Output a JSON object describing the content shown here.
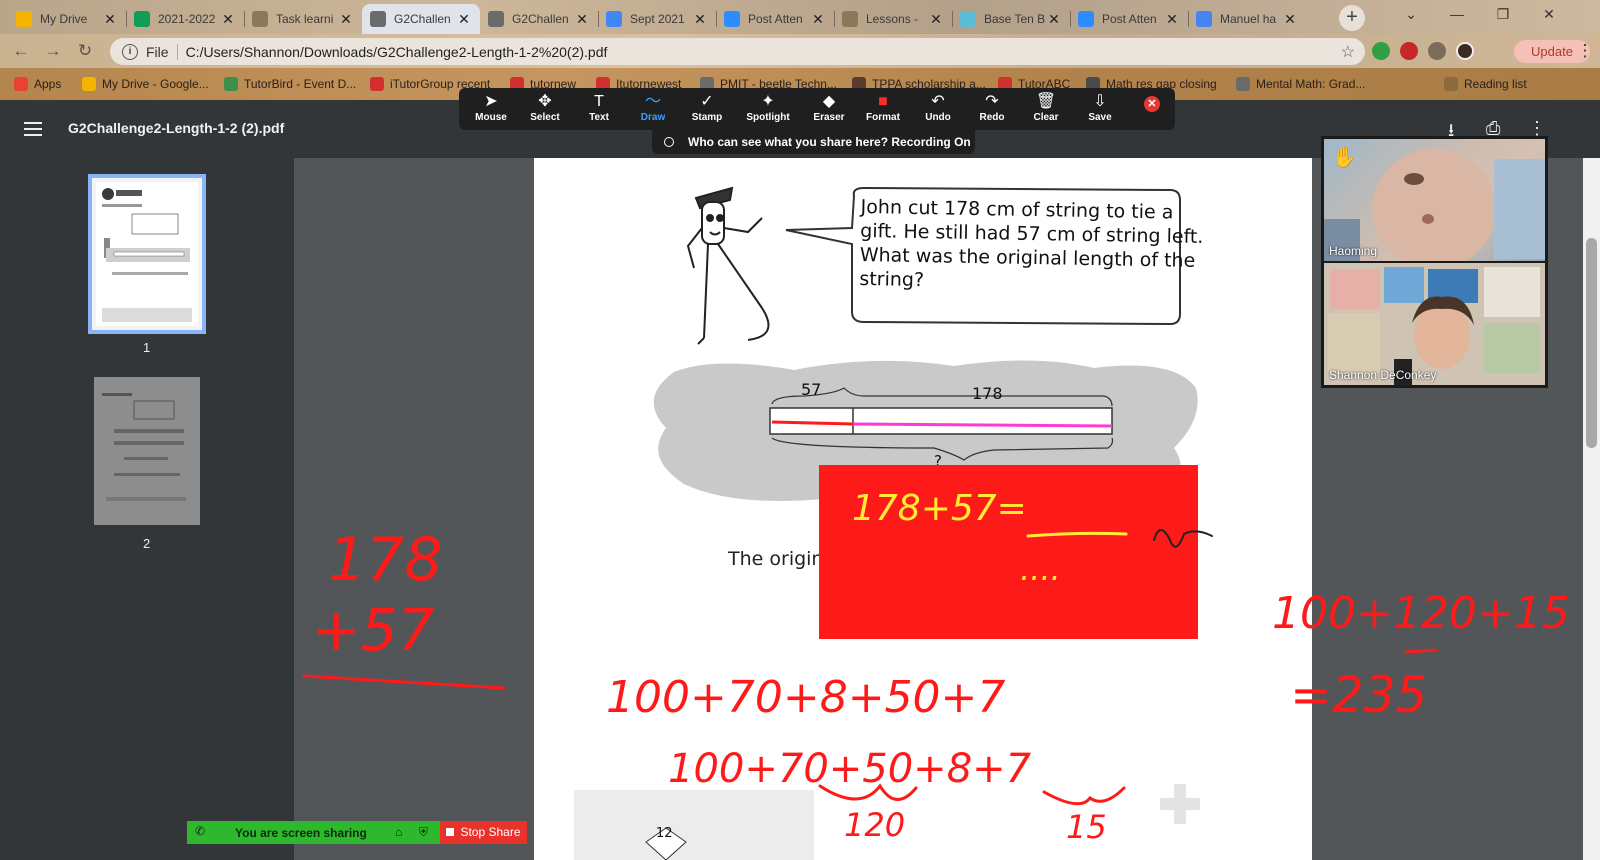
{
  "browser": {
    "tabs": [
      {
        "label": "My Drive",
        "icon": "google-drive-icon",
        "color": "#f4b400",
        "active": false
      },
      {
        "label": "2021-2022",
        "icon": "google-sheets-icon",
        "color": "#0f9d58",
        "active": false
      },
      {
        "label": "Task learni",
        "icon": "document-icon",
        "color": "#8a7a5a",
        "active": false
      },
      {
        "label": "G2Challen",
        "icon": "globe-icon",
        "color": "#6b6b6b",
        "active": true
      },
      {
        "label": "G2Challen",
        "icon": "globe-icon",
        "color": "#6b6b6b",
        "active": false
      },
      {
        "label": "Sept 2021",
        "icon": "google-docs-icon",
        "color": "#4285f4",
        "active": false
      },
      {
        "label": "Post Atten",
        "icon": "zoom-icon",
        "color": "#2d8cff",
        "active": false
      },
      {
        "label": "Lessons -",
        "icon": "document-icon",
        "color": "#8a7a5a",
        "active": false
      },
      {
        "label": "Base Ten B",
        "icon": "app-icon",
        "color": "#5bbcd6",
        "active": false
      },
      {
        "label": "Post Atten",
        "icon": "zoom-icon",
        "color": "#2d8cff",
        "active": false
      },
      {
        "label": "Manuel ha",
        "icon": "google-docs-icon",
        "color": "#4285f4",
        "active": false
      }
    ],
    "scheme": "File",
    "url": "C:/Users/Shannon/Downloads/G2Challenge2-Length-1-2%20(2).pdf",
    "update_label": "Update",
    "bookmarks": [
      {
        "label": "Apps",
        "color": "#e94235"
      },
      {
        "label": "My Drive - Google...",
        "color": "#f4b400"
      },
      {
        "label": "TutorBird - Event D...",
        "color": "#3d8f4a"
      },
      {
        "label": "iTutorGroup recent",
        "color": "#d32f2f"
      },
      {
        "label": "tutornew",
        "color": "#d32f2f"
      },
      {
        "label": "Itutornewest",
        "color": "#d32f2f"
      },
      {
        "label": "PMIT - beetle Techn...",
        "color": "#6b6b6b"
      },
      {
        "label": "TPPA scholarship a...",
        "color": "#5a3b2e"
      },
      {
        "label": "TutorABC",
        "color": "#d32f2f"
      },
      {
        "label": "Math res gap closing",
        "color": "#4a4a4a"
      },
      {
        "label": "Mental Math: Grad...",
        "color": "#6b6b6b"
      },
      {
        "label": "Reading list",
        "color": "#8b6a3e"
      }
    ]
  },
  "pdf": {
    "title": "G2Challenge2-Length-1-2 (2).pdf",
    "thumbnails": [
      {
        "num": "1"
      },
      {
        "num": "2"
      }
    ],
    "speech": [
      "John cut 178 cm of string to tie a",
      "gift. He still had 57 cm of string left.",
      "What was the original length of the",
      "string?"
    ],
    "bar_label_left": "57",
    "bar_label_right": "178",
    "bar_question": "?",
    "partial_sentence": "The origina",
    "page_number": "12"
  },
  "zoom_toolbar": {
    "tools": [
      {
        "label": "Mouse",
        "icon": "mouse-pointer-icon",
        "glyph": "➤"
      },
      {
        "label": "Select",
        "icon": "move-icon",
        "glyph": "✥"
      },
      {
        "label": "Text",
        "icon": "text-icon",
        "glyph": "T"
      },
      {
        "label": "Draw",
        "icon": "draw-icon",
        "glyph": "〜",
        "active": true
      },
      {
        "label": "Stamp",
        "icon": "stamp-icon",
        "glyph": "✓"
      },
      {
        "label": "Spotlight",
        "icon": "spotlight-icon",
        "glyph": "✦"
      },
      {
        "label": "Eraser",
        "icon": "eraser-icon",
        "glyph": "◆"
      },
      {
        "label": "Format",
        "icon": "format-color-icon",
        "glyph": "■",
        "color": "#ff2a2a"
      },
      {
        "label": "Undo",
        "icon": "undo-icon",
        "glyph": "↶"
      },
      {
        "label": "Redo",
        "icon": "redo-icon",
        "glyph": "↷"
      },
      {
        "label": "Clear",
        "icon": "trash-icon",
        "glyph": "🗑"
      },
      {
        "label": "Save",
        "icon": "save-icon",
        "glyph": "⇩"
      }
    ],
    "recording_text": "Who can see what you share here? Recording On"
  },
  "videos": [
    {
      "name": "Haoming"
    },
    {
      "name": "Shannon DeConkey"
    }
  ],
  "share": {
    "status_text": "You are screen sharing",
    "stop_label": "Stop Share"
  },
  "annotations": {
    "colors": {
      "ink": "#ff1a1a",
      "box": "#ff1a1a",
      "highlight": "#ffee33",
      "pink": "#ff3ad2"
    },
    "box_text": "178+57=",
    "box_dots": "....",
    "left_top": "178",
    "left_bottom": "+57",
    "expansion_1": "100+70+8+50+7",
    "expansion_2": "100+70+50+8+7",
    "group_1": "120",
    "group_2": "15",
    "right_sum": "100+120+15",
    "right_result": "=235"
  }
}
